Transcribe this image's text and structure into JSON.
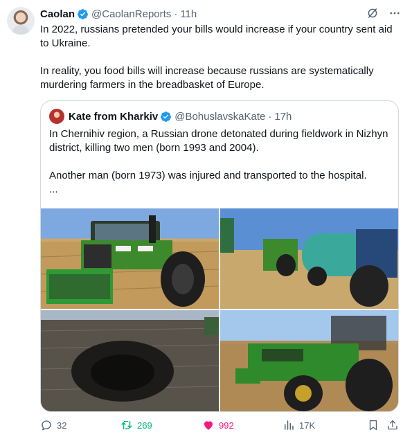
{
  "tweet": {
    "author": {
      "name": "Caolan",
      "handle": "@CaolanReports",
      "separator": "·",
      "time": "11h"
    },
    "text": {
      "para1": "In 2022, russians pretended your bills would increase if your country sent aid to Ukraine.",
      "para2": "In reality, you food bills will increase because russians are systematically murdering farmers in the breadbasket of Europe."
    },
    "quote": {
      "author": {
        "name": "Kate from Kharkiv",
        "handle": "@BohuslavskaKate",
        "separator": "·",
        "time": "17h"
      },
      "text": {
        "para1": "In Chernihiv region, a Russian drone detonated during fieldwork in Nizhyn district, killing two men (born 1993 and 2004).",
        "para2": "Another man (born 1973) was injured and transported to the hospital.",
        "more": "..."
      },
      "photos": [
        "tractor-front-photo",
        "tractor-and-tanker-photo",
        "blast-crater-photo",
        "burned-tractor-photo"
      ]
    },
    "actions": {
      "replies": "32",
      "retweets": "269",
      "likes": "992",
      "views": "17K"
    },
    "colors": {
      "verified": "#1d9bf0",
      "retweet": "#00ba7c",
      "like": "#f91880",
      "muted": "#536471",
      "border": "#cfd9de"
    },
    "icons": [
      "verified-badge-icon",
      "grok-icon",
      "more-icon",
      "reply-icon",
      "retweet-icon",
      "heart-icon",
      "views-icon",
      "bookmark-icon",
      "share-icon"
    ]
  }
}
